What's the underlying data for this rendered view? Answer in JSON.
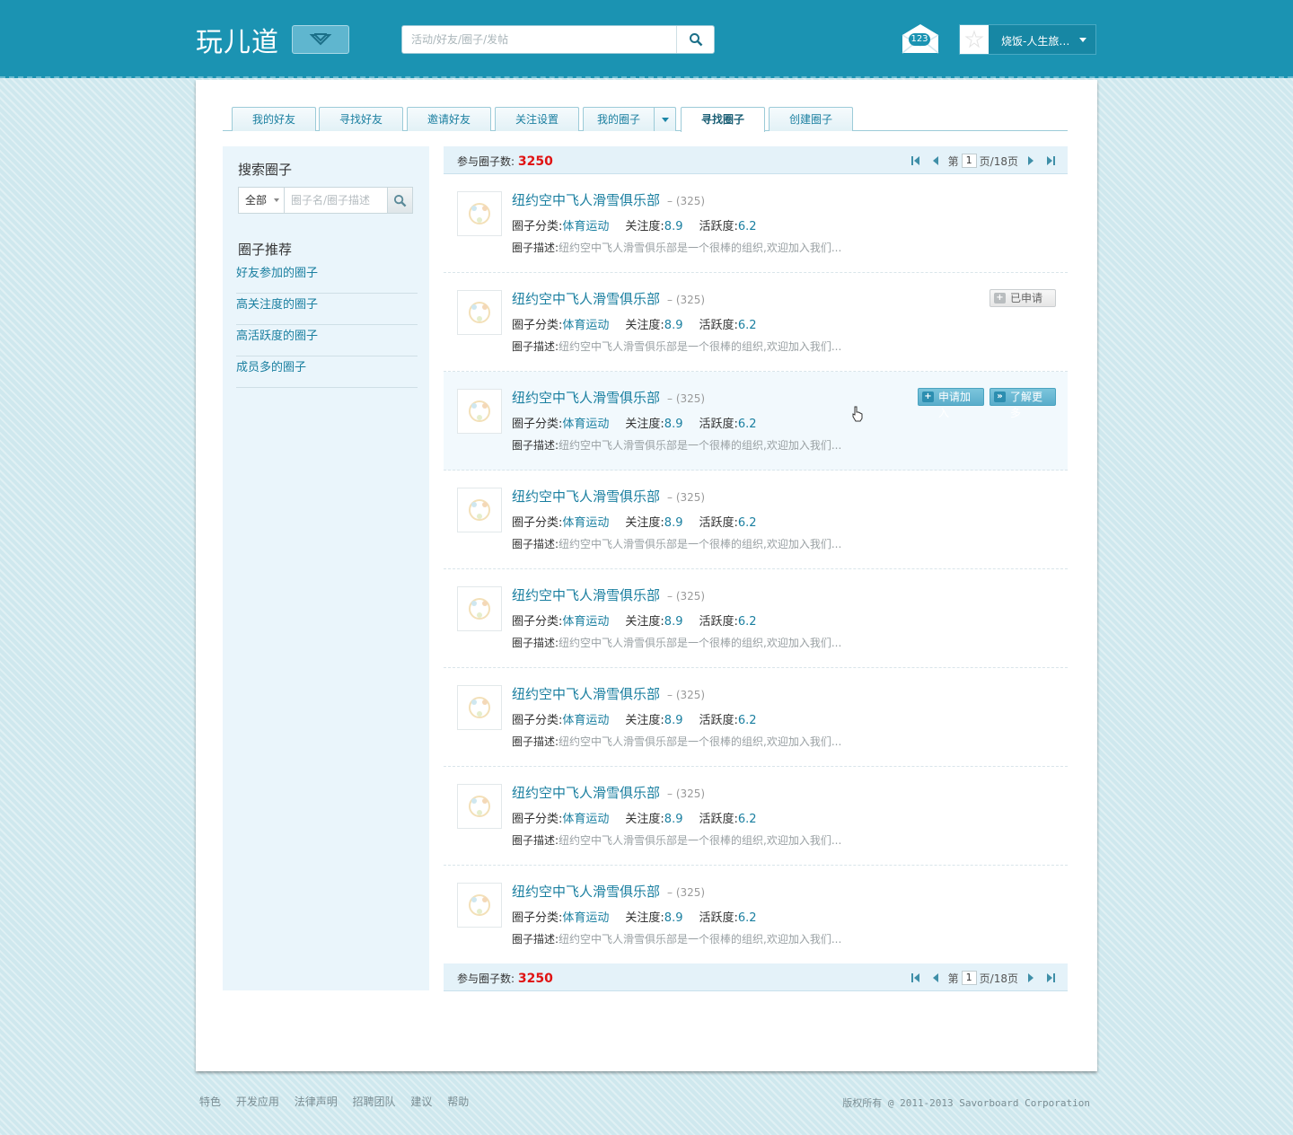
{
  "header": {
    "logo": "玩儿道",
    "search_placeholder": "活动/好友/圈子/发帖",
    "mail_count": "123",
    "user_name": "烧饭-人生旅…"
  },
  "tabs": [
    {
      "label": "我的好友"
    },
    {
      "label": "寻找好友"
    },
    {
      "label": "邀请好友"
    },
    {
      "label": "关注设置"
    },
    {
      "label": "我的圈子"
    },
    {
      "label": "寻找圈子",
      "active": true
    },
    {
      "label": "创建圈子"
    }
  ],
  "sidebar": {
    "search_title": "搜索圈子",
    "select_value": "全部",
    "search_placeholder": "圈子名/圈子描述",
    "rec_title": "圈子推荐",
    "links": [
      "好友参加的圈子",
      "高关注度的圈子",
      "高活跃度的圈子",
      "成员多的圈子"
    ]
  },
  "list": {
    "count_label": "参与圈子数:",
    "count_value": "3250",
    "pager": {
      "prefix": "第",
      "page": "1",
      "suffix": "页/18页"
    },
    "field_category": "圈子分类:",
    "field_follow": "关注度:",
    "field_active": "活跃度:",
    "field_desc": "圈子描述:",
    "btn_applied": "已申请",
    "btn_join": "申请加入",
    "btn_more": "了解更多",
    "items": [
      {
        "title": "纽约空中飞人滑雪俱乐部",
        "count": "– (325)",
        "category": "体育运动",
        "follow": "8.9",
        "active": "6.2",
        "desc": "纽约空中飞人滑雪俱乐部是一个很棒的组织,欢迎加入我们..."
      },
      {
        "title": "纽约空中飞人滑雪俱乐部",
        "count": "– (325)",
        "category": "体育运动",
        "follow": "8.9",
        "active": "6.2",
        "desc": "纽约空中飞人滑雪俱乐部是一个很棒的组织,欢迎加入我们..."
      },
      {
        "title": "纽约空中飞人滑雪俱乐部",
        "count": "– (325)",
        "category": "体育运动",
        "follow": "8.9",
        "active": "6.2",
        "desc": "纽约空中飞人滑雪俱乐部是一个很棒的组织,欢迎加入我们..."
      },
      {
        "title": "纽约空中飞人滑雪俱乐部",
        "count": "– (325)",
        "category": "体育运动",
        "follow": "8.9",
        "active": "6.2",
        "desc": "纽约空中飞人滑雪俱乐部是一个很棒的组织,欢迎加入我们..."
      },
      {
        "title": "纽约空中飞人滑雪俱乐部",
        "count": "– (325)",
        "category": "体育运动",
        "follow": "8.9",
        "active": "6.2",
        "desc": "纽约空中飞人滑雪俱乐部是一个很棒的组织,欢迎加入我们..."
      },
      {
        "title": "纽约空中飞人滑雪俱乐部",
        "count": "– (325)",
        "category": "体育运动",
        "follow": "8.9",
        "active": "6.2",
        "desc": "纽约空中飞人滑雪俱乐部是一个很棒的组织,欢迎加入我们..."
      },
      {
        "title": "纽约空中飞人滑雪俱乐部",
        "count": "– (325)",
        "category": "体育运动",
        "follow": "8.9",
        "active": "6.2",
        "desc": "纽约空中飞人滑雪俱乐部是一个很棒的组织,欢迎加入我们..."
      },
      {
        "title": "纽约空中飞人滑雪俱乐部",
        "count": "– (325)",
        "category": "体育运动",
        "follow": "8.9",
        "active": "6.2",
        "desc": "纽约空中飞人滑雪俱乐部是一个很棒的组织,欢迎加入我们..."
      }
    ]
  },
  "footer": {
    "links": [
      "特色",
      "开发应用",
      "法律声明",
      "招聘团队",
      "建议",
      "帮助"
    ],
    "copyright": "版权所有 @ 2011-2013 Savorboard Corporation"
  },
  "colors": {
    "header_bg": "#1b93b2",
    "link": "#1a7fa0",
    "count_red": "#e01414",
    "sidebar_bg": "#eaf5fb"
  },
  "icons": [
    "chevron-down-icon",
    "search-icon",
    "mail-icon",
    "caret-down-icon",
    "first-page-icon",
    "prev-page-icon",
    "next-page-icon",
    "last-page-icon",
    "plus-icon",
    "double-chevron-right-icon",
    "hand-cursor-icon"
  ]
}
